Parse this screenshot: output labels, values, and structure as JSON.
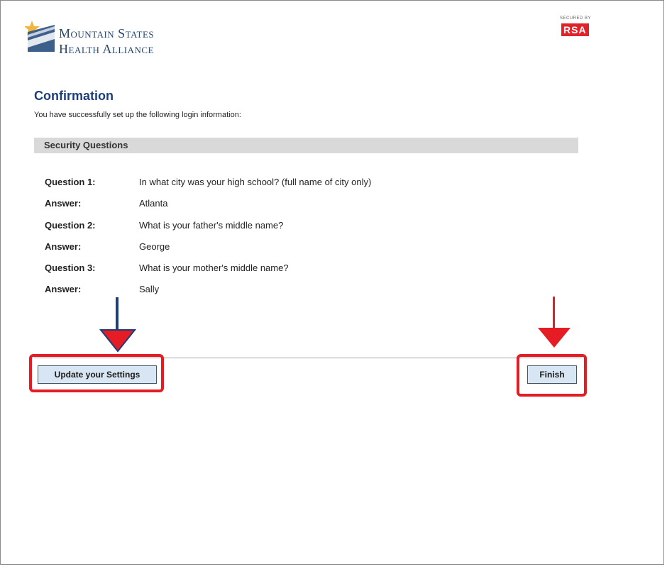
{
  "brand": {
    "name_line1": "Mountain States",
    "name_line2": "Health Alliance",
    "security_badge_caption": "SECURED BY",
    "security_badge_logo": "RSA"
  },
  "page": {
    "title": "Confirmation",
    "subtitle": "You have successfully set up the following login information:"
  },
  "security_questions": {
    "header": "Security Questions",
    "items": [
      {
        "label": "Question 1:",
        "value": "In what city was your high school? (full name of city only)"
      },
      {
        "label": "Answer:",
        "value": "Atlanta"
      },
      {
        "label": "Question 2:",
        "value": "What is your father's middle name?"
      },
      {
        "label": "Answer:",
        "value": "George"
      },
      {
        "label": "Question 3:",
        "value": "What is your mother's middle name?"
      },
      {
        "label": "Answer:",
        "value": "Sally"
      }
    ]
  },
  "actions": {
    "update_label": "Update your Settings",
    "finish_label": "Finish"
  },
  "colors": {
    "title_blue": "#1d3e7a",
    "highlight_red": "#e51c23",
    "button_bg": "#d8e6f4",
    "section_header_bg": "#d9d9d9",
    "rsa_red": "#e0232b"
  },
  "icons": {
    "logo_mark": "mountain-star-logo-icon",
    "annotation_arrow": "arrow-down-icon"
  }
}
